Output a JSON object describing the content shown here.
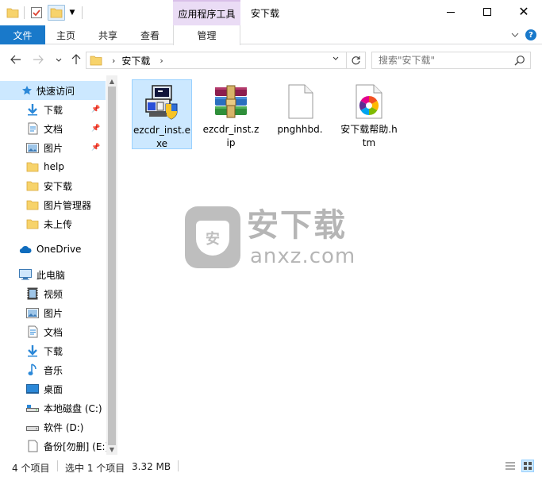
{
  "window": {
    "title": "安下载",
    "context_tab_group": "应用程序工具",
    "minimize": "–",
    "maximize": "□",
    "close": "✕"
  },
  "ribbon": {
    "tabs": [
      {
        "label": "文件"
      },
      {
        "label": "主页"
      },
      {
        "label": "共享"
      },
      {
        "label": "查看"
      },
      {
        "label": "管理"
      }
    ],
    "help": "?"
  },
  "address": {
    "path": [
      "安下载"
    ],
    "search_placeholder": "搜索\"安下载\""
  },
  "nav_pane": {
    "quick_access": "快速访问",
    "quick_items": [
      {
        "label": "下载",
        "icon": "download-icon",
        "pinned": true
      },
      {
        "label": "文档",
        "icon": "document-icon",
        "pinned": true
      },
      {
        "label": "图片",
        "icon": "picture-icon",
        "pinned": true
      },
      {
        "label": "help",
        "icon": "folder-icon",
        "pinned": false
      },
      {
        "label": "安下载",
        "icon": "folder-icon",
        "pinned": false
      },
      {
        "label": "图片管理器",
        "icon": "folder-icon",
        "pinned": false
      },
      {
        "label": "未上传",
        "icon": "folder-icon",
        "pinned": false
      }
    ],
    "onedrive": "OneDrive",
    "this_pc": "此电脑",
    "pc_items": [
      {
        "label": "视频",
        "icon": "video-icon"
      },
      {
        "label": "图片",
        "icon": "picture-icon"
      },
      {
        "label": "文档",
        "icon": "document-icon"
      },
      {
        "label": "下载",
        "icon": "download-icon"
      },
      {
        "label": "音乐",
        "icon": "music-icon"
      },
      {
        "label": "桌面",
        "icon": "desktop-icon"
      },
      {
        "label": "本地磁盘 (C:)",
        "icon": "drive-icon"
      },
      {
        "label": "软件 (D:)",
        "icon": "drive-icon"
      },
      {
        "label": "备份[勿删] (E:)",
        "icon": "drive-icon"
      }
    ]
  },
  "files": [
    {
      "name": "ezcdr_inst.exe",
      "icon": "installer-icon",
      "selected": true
    },
    {
      "name": "ezcdr_inst.zip",
      "icon": "winrar-archive-icon",
      "selected": false
    },
    {
      "name": "pnghhbd.",
      "icon": "blank-file-icon",
      "selected": false
    },
    {
      "name": "安下载帮助.htm",
      "icon": "htm-file-icon",
      "selected": false
    }
  ],
  "watermark": {
    "cn": "安下载",
    "en": "anxz.com",
    "shield": "安"
  },
  "status": {
    "item_count": "4 个项目",
    "selected": "选中 1 个项目",
    "size": "3.32 MB"
  },
  "colors": {
    "accent": "#1979ca",
    "selection": "#cce8ff",
    "context_tab": "#eadcf5",
    "folder": "#f7d36b"
  }
}
